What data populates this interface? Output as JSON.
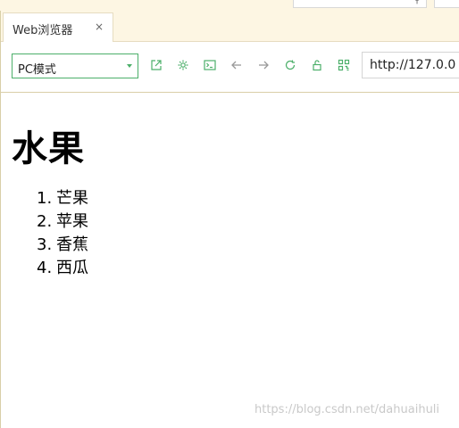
{
  "tab": {
    "title": "Web浏览器",
    "close_glyph": "×"
  },
  "toolbar": {
    "mode_value": "PC模式",
    "url": "http://127.0.0",
    "icons": [
      "open-external-icon",
      "settings-gear-icon",
      "console-icon",
      "back-arrow-icon",
      "forward-arrow-icon",
      "refresh-icon",
      "unlock-icon",
      "qr-code-icon"
    ],
    "accent_color": "#4caf6a"
  },
  "page": {
    "heading": "水果",
    "items": [
      {
        "num": "1.",
        "text": "芒果"
      },
      {
        "num": "2.",
        "text": "苹果"
      },
      {
        "num": "3.",
        "text": "香蕉"
      },
      {
        "num": "4.",
        "text": "西瓜"
      }
    ]
  },
  "watermark": "https://blog.csdn.net/dahuaihuli"
}
